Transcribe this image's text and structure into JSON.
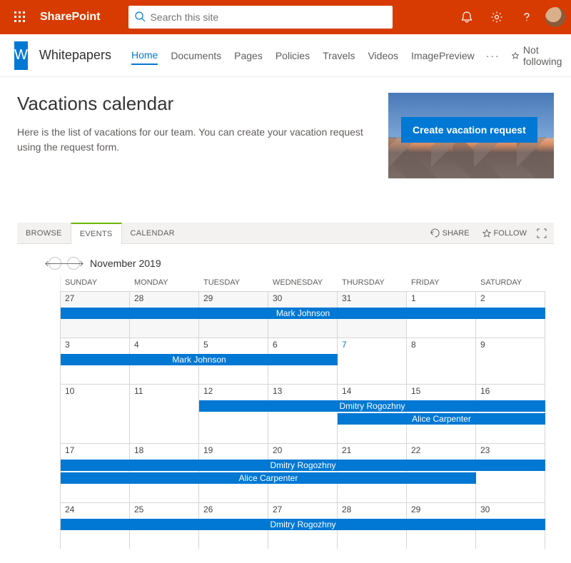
{
  "suitebar": {
    "brand": "SharePoint",
    "search_placeholder": "Search this site"
  },
  "site": {
    "logo_letter": "W",
    "title": "Whitepapers",
    "nav": [
      "Home",
      "Documents",
      "Pages",
      "Policies",
      "Travels",
      "Videos",
      "ImagePreview"
    ],
    "nav_active_index": 0,
    "follow_label": "Not following"
  },
  "page": {
    "title": "Vacations calendar",
    "description": "Here is the list of vacations for our team. You can create your vacation request using the request form.",
    "cta_label": "Create vacation request"
  },
  "ribbon": {
    "tabs": [
      "BROWSE",
      "EVENTS",
      "CALENDAR"
    ],
    "active_tab_index": 1,
    "share_label": "SHARE",
    "follow_label": "FOLLOW"
  },
  "calendar": {
    "month_label": "November 2019",
    "day_headers": [
      "SUNDAY",
      "MONDAY",
      "TUESDAY",
      "WEDNESDAY",
      "THURSDAY",
      "FRIDAY",
      "SATURDAY"
    ],
    "weeks": [
      {
        "dates": [
          {
            "n": 27,
            "other": true
          },
          {
            "n": 28,
            "other": true
          },
          {
            "n": 29,
            "other": true
          },
          {
            "n": 30,
            "other": true
          },
          {
            "n": 31,
            "other": true
          },
          {
            "n": 1
          },
          {
            "n": 2
          }
        ],
        "events": [
          {
            "label": "Mark Johnson",
            "row": 0,
            "start": 0,
            "end": 7
          }
        ]
      },
      {
        "dates": [
          {
            "n": 3
          },
          {
            "n": 4
          },
          {
            "n": 5
          },
          {
            "n": 6
          },
          {
            "n": 7,
            "today": true
          },
          {
            "n": 8
          },
          {
            "n": 9
          }
        ],
        "events": [
          {
            "label": "Mark Johnson",
            "row": 0,
            "start": 0,
            "end": 4
          }
        ]
      },
      {
        "dates": [
          {
            "n": 10
          },
          {
            "n": 11
          },
          {
            "n": 12
          },
          {
            "n": 13
          },
          {
            "n": 14
          },
          {
            "n": 15
          },
          {
            "n": 16
          }
        ],
        "events": [
          {
            "label": "Dmitry Rogozhny",
            "row": 0,
            "start": 2,
            "end": 7
          },
          {
            "label": "Alice Carpenter",
            "row": 1,
            "start": 4,
            "end": 7
          }
        ]
      },
      {
        "dates": [
          {
            "n": 17
          },
          {
            "n": 18
          },
          {
            "n": 19
          },
          {
            "n": 20
          },
          {
            "n": 21
          },
          {
            "n": 22
          },
          {
            "n": 23
          }
        ],
        "events": [
          {
            "label": "Dmitry Rogozhny",
            "row": 0,
            "start": 0,
            "end": 7
          },
          {
            "label": "Alice Carpenter",
            "row": 1,
            "start": 0,
            "end": 6
          }
        ]
      },
      {
        "dates": [
          {
            "n": 24
          },
          {
            "n": 25
          },
          {
            "n": 26
          },
          {
            "n": 27
          },
          {
            "n": 28
          },
          {
            "n": 29
          },
          {
            "n": 30
          }
        ],
        "events": [
          {
            "label": "Dmitry Rogozhny",
            "row": 0,
            "start": 0,
            "end": 7
          }
        ]
      }
    ]
  }
}
